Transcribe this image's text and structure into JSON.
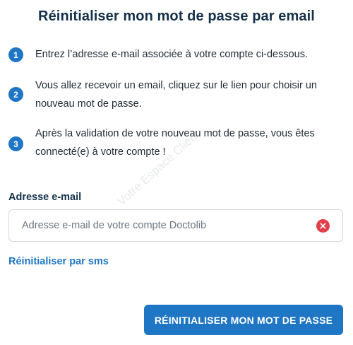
{
  "page": {
    "title": "Réinitialiser mon mot de passe par email"
  },
  "steps": [
    {
      "number": "1",
      "text": "Entrez l’adresse e-mail associée à votre compte ci-dessous."
    },
    {
      "number": "2",
      "text": "Vous allez recevoir un email, cliquez sur le lien pour choisir un nouveau mot de passe."
    },
    {
      "number": "3",
      "text": "Après la validation de votre nouveau mot de passe, vous êtes connecté(e) à votre compte !"
    }
  ],
  "email": {
    "label": "Adresse e-mail",
    "value": "",
    "placeholder": "Adresse e-mail de votre compte Doctolib",
    "clear_icon": "close-circle-icon"
  },
  "links": {
    "sms": "Réinitialiser par sms"
  },
  "buttons": {
    "reset": "RÉINITIALISER MON MOT DE PASSE"
  },
  "watermark": "Votre Espace Client",
  "colors": {
    "primary": "#1f76c5",
    "title": "#14304a",
    "clear": "#e0414b",
    "border": "#d4d9de"
  }
}
